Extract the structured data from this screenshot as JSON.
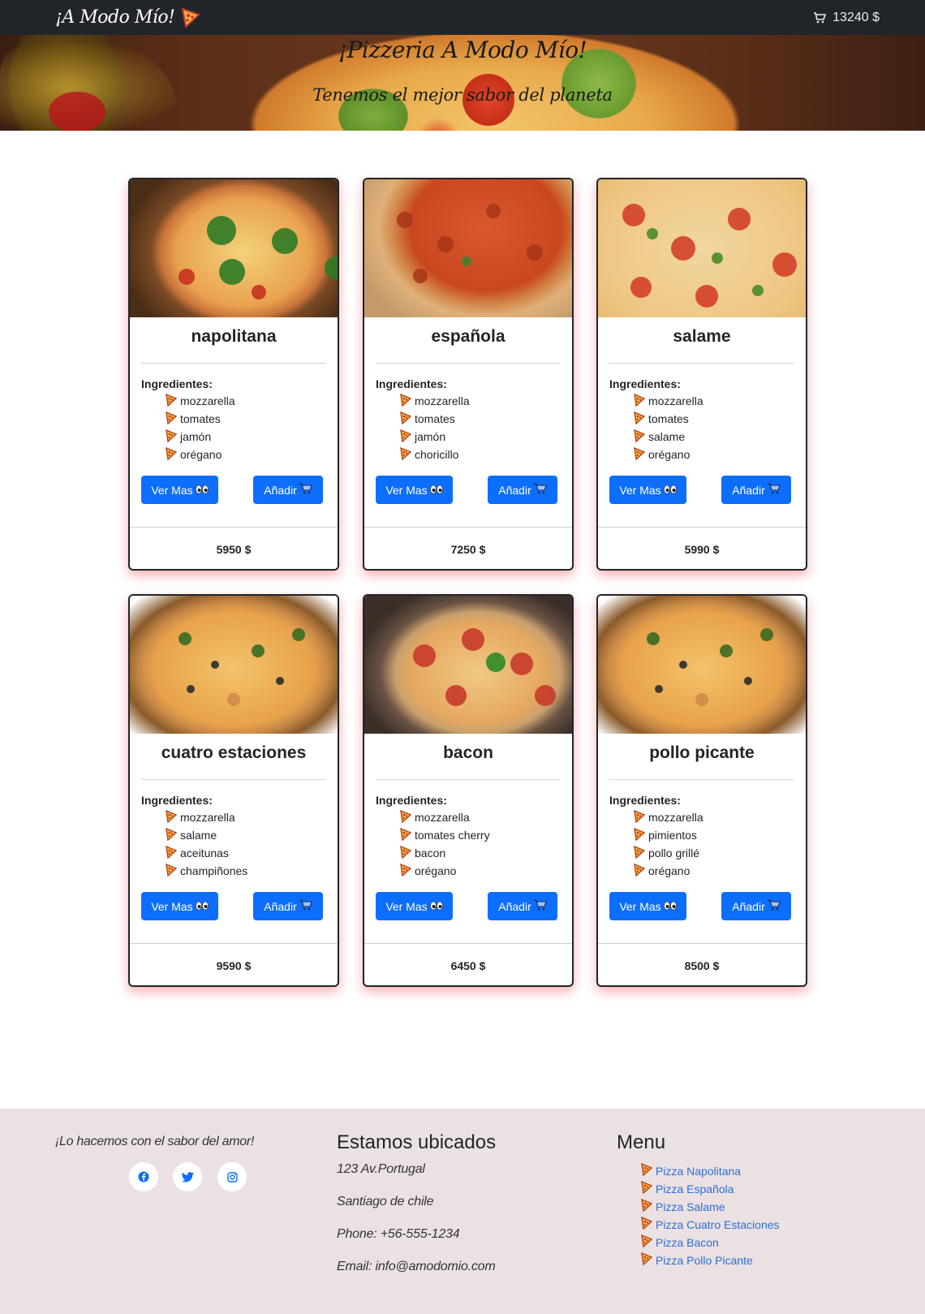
{
  "navbar": {
    "brand": "¡A Modo Mío!",
    "cart_total": "13240 $",
    "icons": {
      "brand": "pizza-icon",
      "cart": "cart-icon"
    }
  },
  "hero": {
    "title": "¡Pizzeria A Modo Mío!",
    "subtitle": "Tenemos el mejor sabor del planeta"
  },
  "labels": {
    "ingredients": "Ingredientes:",
    "more_button": "Ver Mas",
    "add_button": "Añadir"
  },
  "pizzas": [
    {
      "name": "napolitana",
      "ingredients": [
        "mozzarella",
        "tomates",
        "jamón",
        "orégano"
      ],
      "price": "5950 $"
    },
    {
      "name": "española",
      "ingredients": [
        "mozzarella",
        "tomates",
        "jamón",
        "choricillo"
      ],
      "price": "7250 $"
    },
    {
      "name": "salame",
      "ingredients": [
        "mozzarella",
        "tomates",
        "salame",
        "orégano"
      ],
      "price": "5990 $"
    },
    {
      "name": "cuatro estaciones",
      "ingredients": [
        "mozzarella",
        "salame",
        "aceitunas",
        "champiñones"
      ],
      "price": "9590 $"
    },
    {
      "name": "bacon",
      "ingredients": [
        "mozzarella",
        "tomates cherry",
        "bacon",
        "orégano"
      ],
      "price": "6450 $"
    },
    {
      "name": "pollo picante",
      "ingredients": [
        "mozzarella",
        "pimientos",
        "pollo grillé",
        "orégano"
      ],
      "price": "8500 $"
    }
  ],
  "footer": {
    "slogan": "¡Lo hacemos con el sabor del amor!",
    "social": [
      "facebook-icon",
      "twitter-icon",
      "instagram-icon"
    ],
    "location_heading": "Estamos ubicados",
    "address": "123 Av.Portugal",
    "city": "Santiago de chile",
    "phone": "Phone: +56-555-1234",
    "email": "Email: info@amodomio.com",
    "menu_heading": "Menu",
    "menu_links": [
      "Pizza Napolitana",
      "Pizza Española",
      "Pizza Salame",
      "Pizza Cuatro Estaciones",
      "Pizza Bacon",
      "Pizza Pollo Picante"
    ]
  },
  "colors": {
    "navbar_bg": "#212529",
    "primary_button": "#0d6efd",
    "card_glow": "#f05050",
    "footer_bg": "#ebe1e3",
    "link": "#2b6fd8"
  }
}
